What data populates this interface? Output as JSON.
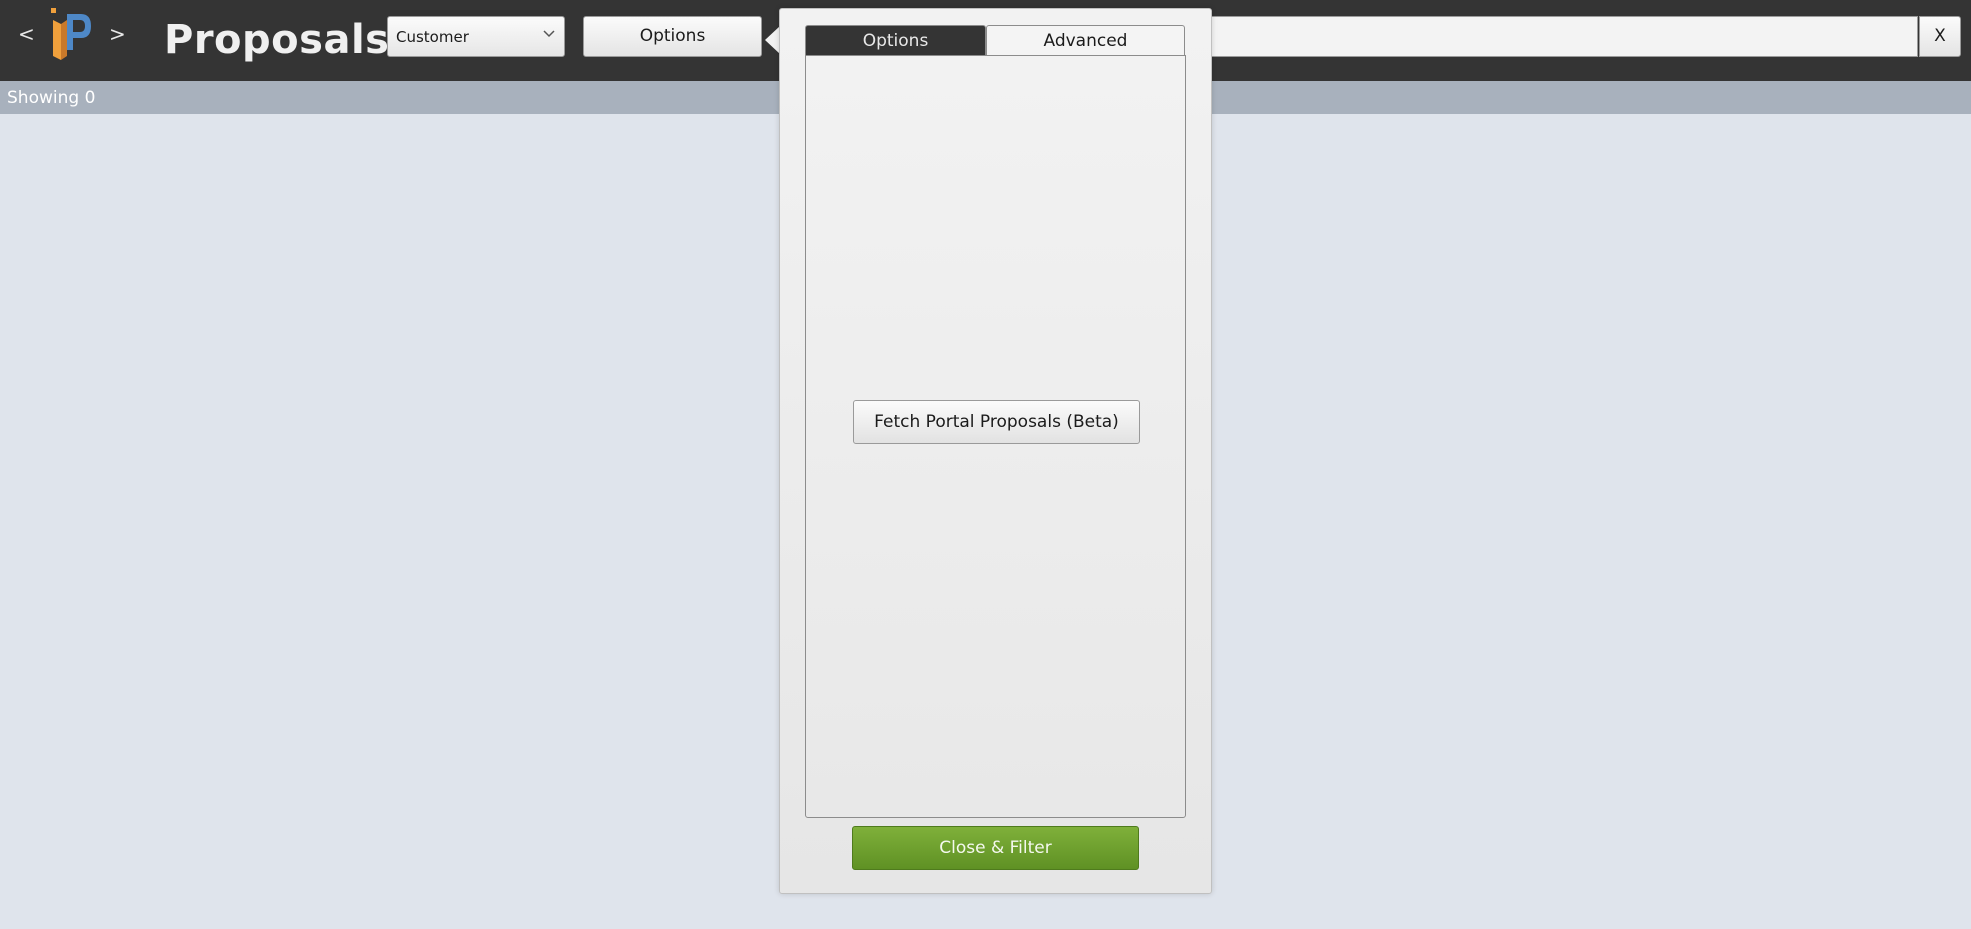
{
  "header": {
    "back_label": "<",
    "forward_label": ">",
    "title": "Proposals",
    "logo_icon": "proposals-logo-icon",
    "filter_select": {
      "selected": "Customer",
      "icon": "chevron-down-icon"
    },
    "options_label": "Options",
    "search": {
      "value": "",
      "placeholder": ""
    },
    "clear_label": "X"
  },
  "status": {
    "text": "Showing 0"
  },
  "popover": {
    "tabs": [
      {
        "label": "Options",
        "active": false
      },
      {
        "label": "Advanced",
        "active": true
      }
    ],
    "fetch_button_label": "Fetch Portal Proposals (Beta)",
    "close_filter_label": "Close & Filter"
  },
  "colors": {
    "topbar": "#343434",
    "status_bar": "#a8b1bd",
    "background": "#dfe4ec",
    "accent_green": "#6fa02f",
    "logo_orange": "#f0a03c",
    "logo_blue": "#4e88c7"
  }
}
